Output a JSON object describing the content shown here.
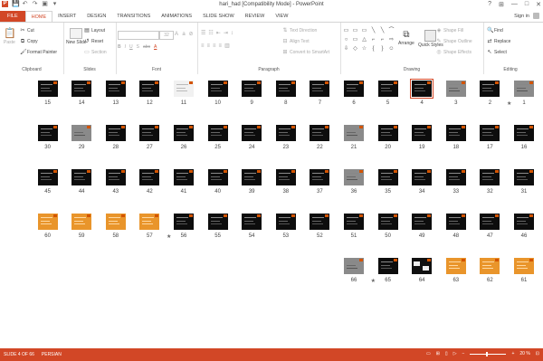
{
  "window": {
    "title": "hari_had [Compatibility Mode] - PowerPoint",
    "min": "—",
    "max": "□",
    "close": "✕",
    "help": "?",
    "ribbon_display": "⊞"
  },
  "qat": {
    "app_icon": "P",
    "save": "💾",
    "undo": "↶",
    "redo": "↷",
    "start": "▣",
    "customize": "▾"
  },
  "tabs": [
    "FILE",
    "HOME",
    "INSERT",
    "DESIGN",
    "TRANSITIONS",
    "ANIMATIONS",
    "SLIDE SHOW",
    "REVIEW",
    "VIEW"
  ],
  "active_tab": "HOME",
  "signin": "Sign in",
  "ribbon": {
    "clipboard": {
      "paste": "Paste",
      "cut": "Cut",
      "copy": "Copy",
      "format_painter": "Format Painter",
      "label": "Clipboard"
    },
    "slides": {
      "new_slide": "New Slide",
      "layout": "Layout",
      "reset": "Reset",
      "section": "Section",
      "label": "Slides"
    },
    "font": {
      "size": "32",
      "label": "Font",
      "bold": "B",
      "italic": "I",
      "underline": "U",
      "shadow": "S",
      "strike": "abc",
      "font_color": "A"
    },
    "paragraph": {
      "text_direction": "Text Direction",
      "align_text": "Align Text",
      "convert": "Convert to SmartArt",
      "label": "Paragraph"
    },
    "drawing": {
      "arrange": "Arrange",
      "quick_styles": "Quick Styles",
      "shape_fill": "Shape Fill",
      "shape_outline": "Shape Outline",
      "shape_effects": "Shape Effects",
      "label": "Drawing"
    },
    "editing": {
      "find": "Find",
      "replace": "Replace",
      "select": "Select",
      "label": "Editing"
    }
  },
  "shape_glyphs": [
    "▭",
    "▭",
    "▭",
    "╲",
    "╲",
    "⌒",
    "○",
    "▭",
    "△",
    "⌐",
    "⌐",
    "⇨",
    "⇩",
    "◇",
    "☆",
    "{",
    "}",
    "☺"
  ],
  "slides": [
    {
      "n": "1",
      "style": "photo",
      "mark": "★"
    },
    {
      "n": "2",
      "style": "dark"
    },
    {
      "n": "3",
      "style": "photo"
    },
    {
      "n": "4",
      "style": "dark",
      "selected": true
    },
    {
      "n": "5",
      "style": "dark"
    },
    {
      "n": "6",
      "style": "dark"
    },
    {
      "n": "7",
      "style": "dark"
    },
    {
      "n": "8",
      "style": "dark"
    },
    {
      "n": "9",
      "style": "dark"
    },
    {
      "n": "10",
      "style": "dark"
    },
    {
      "n": "11",
      "style": "white"
    },
    {
      "n": "12",
      "style": "dark"
    },
    {
      "n": "13",
      "style": "dark"
    },
    {
      "n": "14",
      "style": "dark"
    },
    {
      "n": "15",
      "style": "dark"
    },
    {
      "n": "16",
      "style": "dark"
    },
    {
      "n": "17",
      "style": "dark"
    },
    {
      "n": "18",
      "style": "dark"
    },
    {
      "n": "19",
      "style": "dark"
    },
    {
      "n": "20",
      "style": "dark"
    },
    {
      "n": "21",
      "style": "photo"
    },
    {
      "n": "22",
      "style": "dark"
    },
    {
      "n": "23",
      "style": "dark"
    },
    {
      "n": "24",
      "style": "dark"
    },
    {
      "n": "25",
      "style": "dark"
    },
    {
      "n": "26",
      "style": "dark"
    },
    {
      "n": "27",
      "style": "dark"
    },
    {
      "n": "28",
      "style": "dark"
    },
    {
      "n": "29",
      "style": "photo"
    },
    {
      "n": "30",
      "style": "dark"
    },
    {
      "n": "31",
      "style": "dark"
    },
    {
      "n": "32",
      "style": "dark"
    },
    {
      "n": "33",
      "style": "dark"
    },
    {
      "n": "34",
      "style": "dark"
    },
    {
      "n": "35",
      "style": "dark"
    },
    {
      "n": "36",
      "style": "photo"
    },
    {
      "n": "37",
      "style": "dark"
    },
    {
      "n": "38",
      "style": "dark"
    },
    {
      "n": "39",
      "style": "dark"
    },
    {
      "n": "40",
      "style": "dark"
    },
    {
      "n": "41",
      "style": "dark"
    },
    {
      "n": "42",
      "style": "dark"
    },
    {
      "n": "43",
      "style": "dark"
    },
    {
      "n": "44",
      "style": "dark"
    },
    {
      "n": "45",
      "style": "dark"
    },
    {
      "n": "46",
      "style": "dark"
    },
    {
      "n": "47",
      "style": "dark"
    },
    {
      "n": "48",
      "style": "dark"
    },
    {
      "n": "49",
      "style": "dark"
    },
    {
      "n": "50",
      "style": "dark"
    },
    {
      "n": "51",
      "style": "dark"
    },
    {
      "n": "52",
      "style": "dark"
    },
    {
      "n": "53",
      "style": "dark"
    },
    {
      "n": "54",
      "style": "dark"
    },
    {
      "n": "55",
      "style": "dark"
    },
    {
      "n": "56",
      "style": "dark",
      "mark": "★"
    },
    {
      "n": "57",
      "style": "orange"
    },
    {
      "n": "58",
      "style": "orange"
    },
    {
      "n": "59",
      "style": "orange"
    },
    {
      "n": "60",
      "style": "orange"
    },
    {
      "n": "61",
      "style": "orange"
    },
    {
      "n": "62",
      "style": "orange"
    },
    {
      "n": "63",
      "style": "orange"
    },
    {
      "n": "64",
      "style": "boxes"
    },
    {
      "n": "65",
      "style": "dark",
      "mark": "★"
    },
    {
      "n": "66",
      "style": "photo"
    }
  ],
  "status": {
    "slide": "SLIDE 4 OF 66",
    "language": "PERSIAN",
    "zoom": "20 %",
    "zoom_minus": "−",
    "zoom_plus": "+",
    "fit": "⊡"
  },
  "colors": {
    "accent": "#d24726",
    "slide_accent": "#d35400"
  }
}
